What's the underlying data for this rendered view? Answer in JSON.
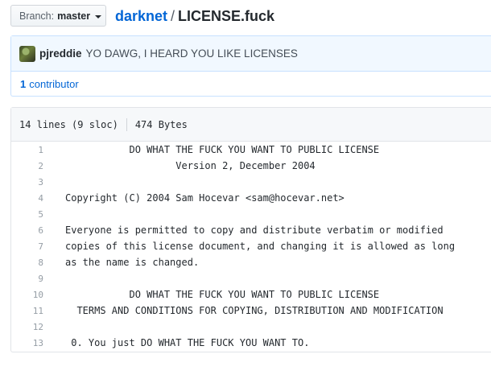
{
  "branch": {
    "prefix": "Branch:",
    "name": "master"
  },
  "breadcrumb": {
    "repo": "darknet",
    "separator": "/",
    "file": "LICENSE.fuck"
  },
  "commit": {
    "author": "pjreddie",
    "message": "YO DAWG, I HEARD YOU LIKE LICENSES"
  },
  "contributors": {
    "count": "1",
    "label": "contributor"
  },
  "file_info": {
    "lines": "14 lines (9 sloc)",
    "size": "474 Bytes"
  },
  "code_lines": [
    {
      "n": "1",
      "text": "           DO WHAT THE FUCK YOU WANT TO PUBLIC LICENSE"
    },
    {
      "n": "2",
      "text": "                   Version 2, December 2004"
    },
    {
      "n": "3",
      "text": ""
    },
    {
      "n": "4",
      "text": "Copyright (C) 2004 Sam Hocevar <sam@hocevar.net>"
    },
    {
      "n": "5",
      "text": ""
    },
    {
      "n": "6",
      "text": "Everyone is permitted to copy and distribute verbatim or modified"
    },
    {
      "n": "7",
      "text": "copies of this license document, and changing it is allowed as long"
    },
    {
      "n": "8",
      "text": "as the name is changed."
    },
    {
      "n": "9",
      "text": ""
    },
    {
      "n": "10",
      "text": "           DO WHAT THE FUCK YOU WANT TO PUBLIC LICENSE"
    },
    {
      "n": "11",
      "text": "  TERMS AND CONDITIONS FOR COPYING, DISTRIBUTION AND MODIFICATION"
    },
    {
      "n": "12",
      "text": ""
    },
    {
      "n": "13",
      "text": " 0. You just DO WHAT THE FUCK YOU WANT TO."
    }
  ]
}
